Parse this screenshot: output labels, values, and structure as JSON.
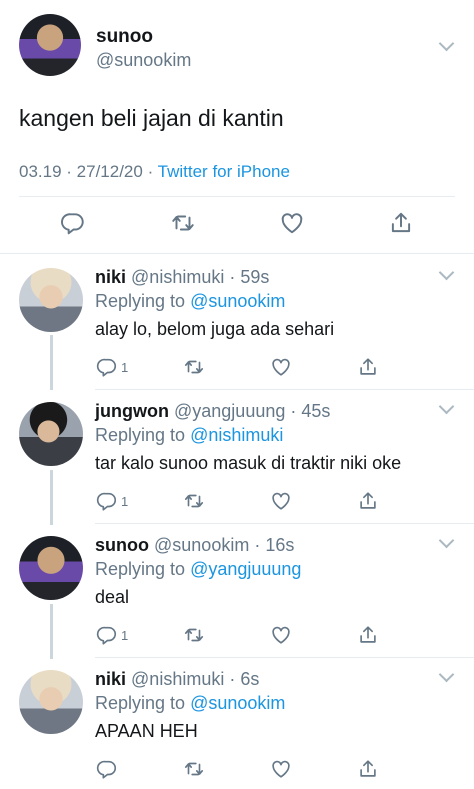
{
  "main_tweet": {
    "display_name": "sunoo",
    "handle": "@sunookim",
    "text": "kangen beli jajan di kantin",
    "time": "03.19",
    "date": "27/12/20",
    "source": "Twitter for iPhone"
  },
  "replies": [
    {
      "display_name": "niki",
      "handle": "@nishimuki",
      "age": "59s",
      "replying_label": "Replying to",
      "replying_to": "@sunookim",
      "text": "alay lo, belom juga ada sehari",
      "reply_count": "1"
    },
    {
      "display_name": "jungwon",
      "handle": "@yangjuuung",
      "age": "45s",
      "replying_label": "Replying to",
      "replying_to": "@nishimuki",
      "text": "tar kalo sunoo masuk di traktir niki oke",
      "reply_count": "1"
    },
    {
      "display_name": "sunoo",
      "handle": "@sunookim",
      "age": "16s",
      "replying_label": "Replying to",
      "replying_to": "@yangjuuung",
      "text": "deal",
      "reply_count": "1"
    },
    {
      "display_name": "niki",
      "handle": "@nishimuki",
      "age": "6s",
      "replying_label": "Replying to",
      "replying_to": "@sunookim",
      "text": "APAAN HEH",
      "reply_count": ""
    }
  ],
  "colors": {
    "link": "#1b95e0",
    "secondary": "#657786",
    "icon": "#657786",
    "divider": "#e6ecf0"
  },
  "icons": [
    "reply-icon",
    "retweet-icon",
    "like-icon",
    "share-icon",
    "chevron-down-icon"
  ]
}
